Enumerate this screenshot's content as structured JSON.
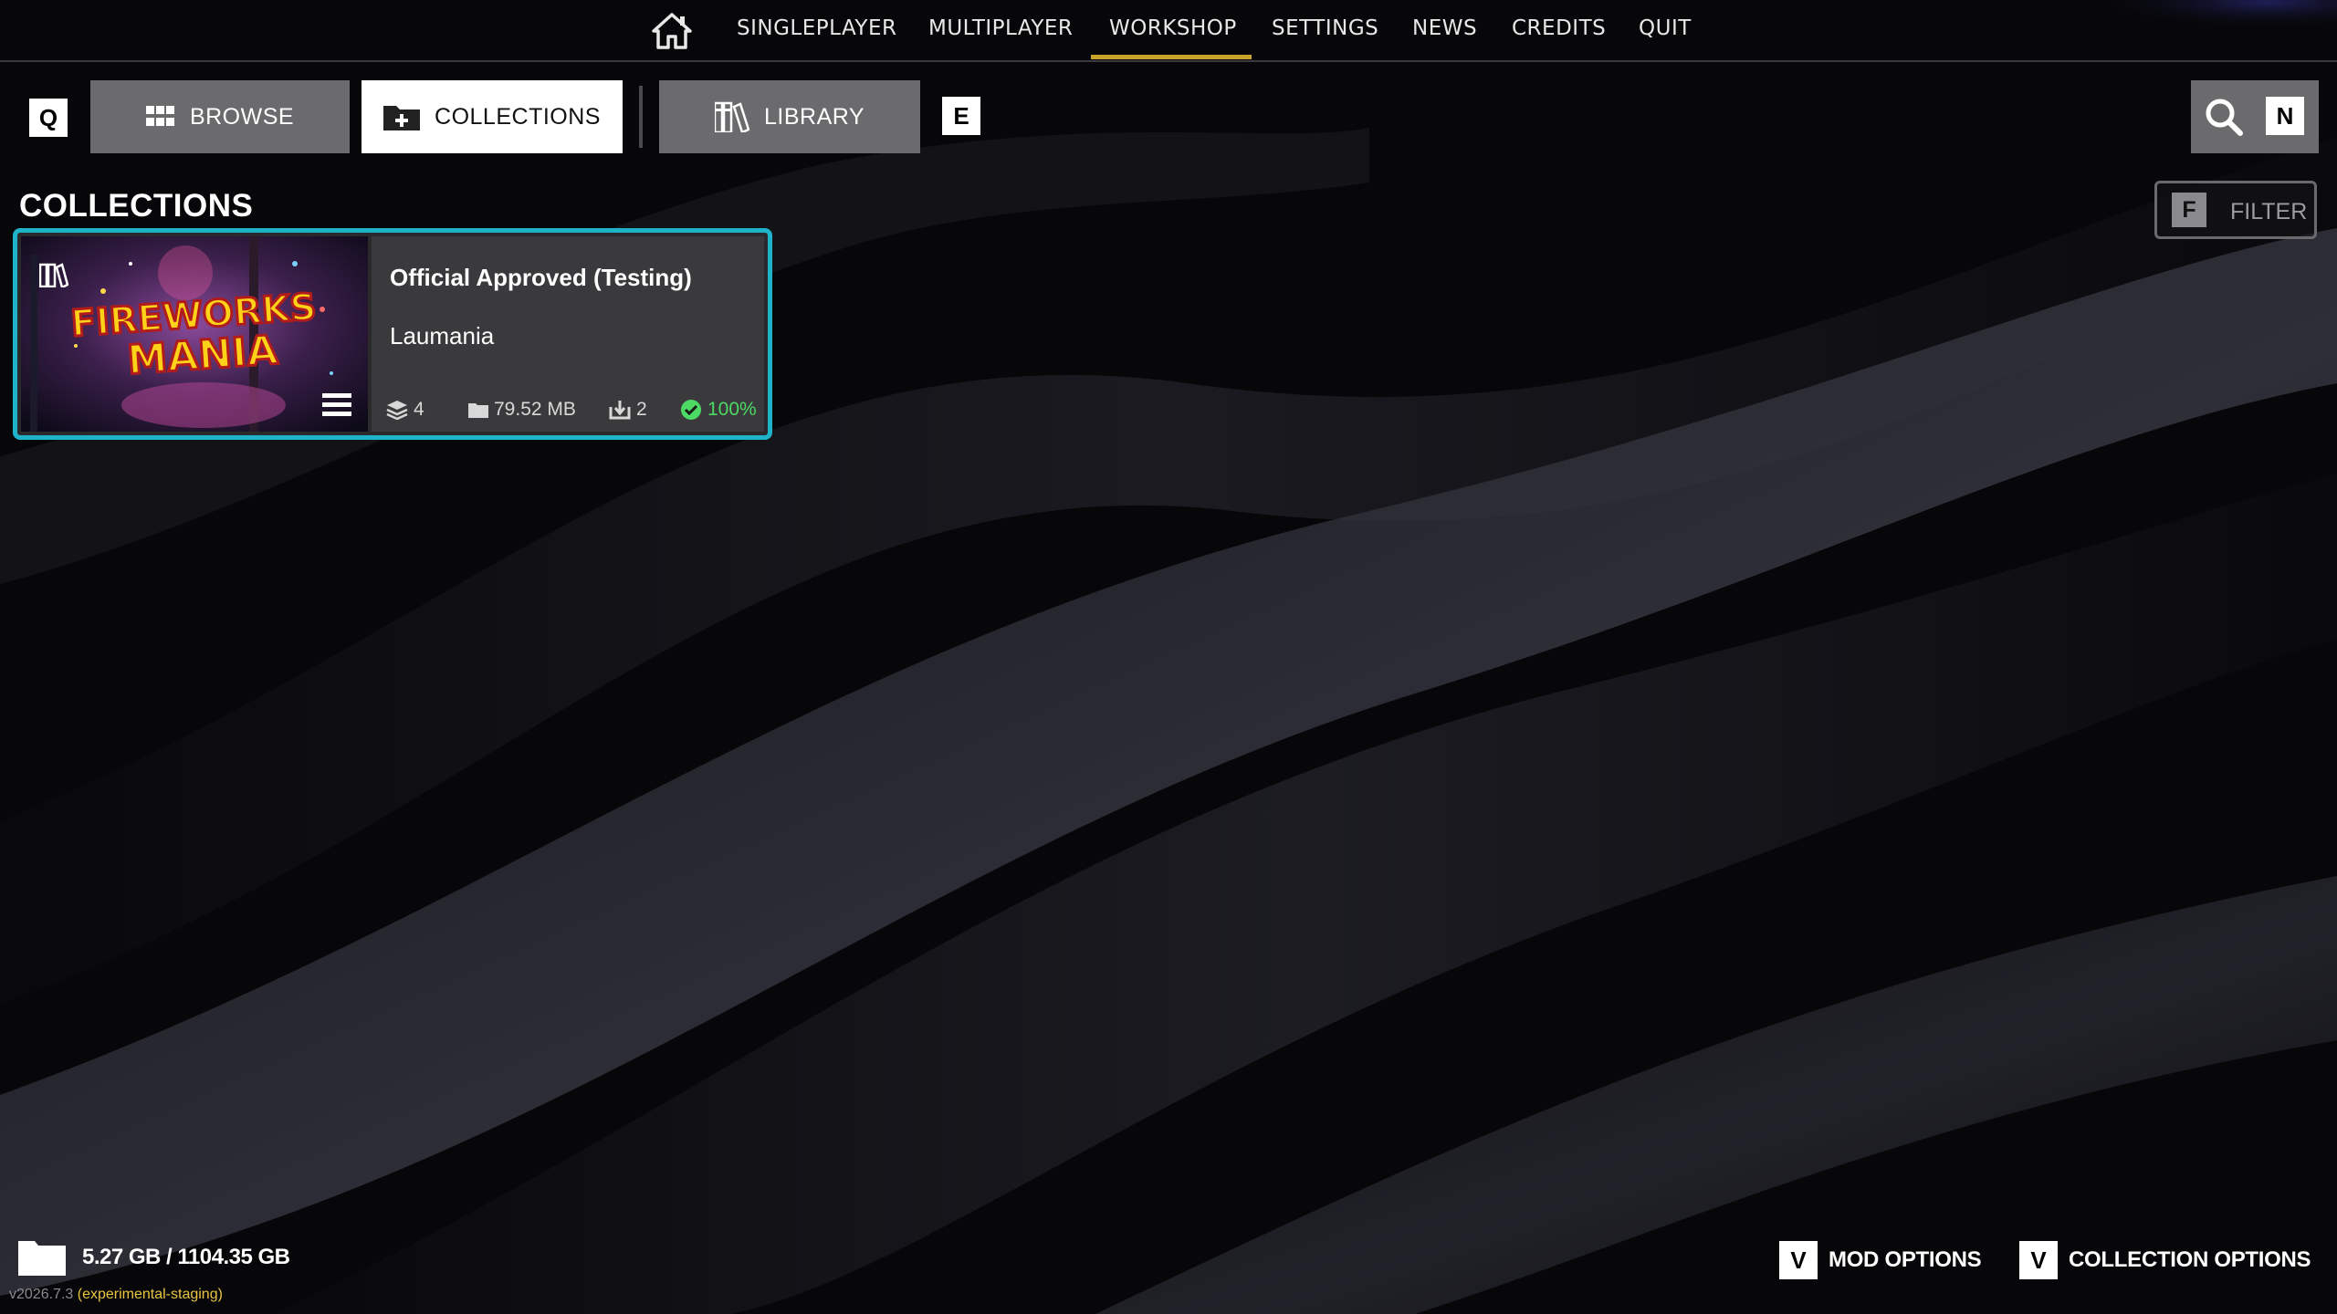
{
  "nav": {
    "items": [
      "SINGLEPLAYER",
      "MULTIPLAYER",
      "WORKSHOP",
      "SETTINGS",
      "NEWS",
      "CREDITS",
      "QUIT"
    ],
    "active": "WORKSHOP",
    "accent_color": "#c9a227"
  },
  "tabs": {
    "prev_key": "Q",
    "next_key": "E",
    "browse": "BROWSE",
    "collections": "COLLECTIONS",
    "library": "LIBRARY",
    "active": "COLLECTIONS"
  },
  "search": {
    "key": "N",
    "icon": "search-icon"
  },
  "section_title": "COLLECTIONS",
  "filter": {
    "key": "F",
    "label": "FILTER"
  },
  "collections": [
    {
      "title": "Official Approved (Testing)",
      "author": "Laumania",
      "thumbnail_text": [
        "FIREWORKS",
        "MANIA"
      ],
      "mod_count": "4",
      "size": "79.52 MB",
      "downloads": "2",
      "progress_label": "100%",
      "progress": 1.0,
      "selected_border_color": "#1fb3c9",
      "status_color": "#4cd964"
    }
  ],
  "footer": {
    "storage": "5.27 GB / 1104.35 GB",
    "version": "v2026.7.3",
    "branch": "(experimental-staging)",
    "mod_options_key": "V",
    "mod_options": "MOD OPTIONS",
    "collection_options_key": "V",
    "collection_options": "COLLECTION OPTIONS"
  }
}
